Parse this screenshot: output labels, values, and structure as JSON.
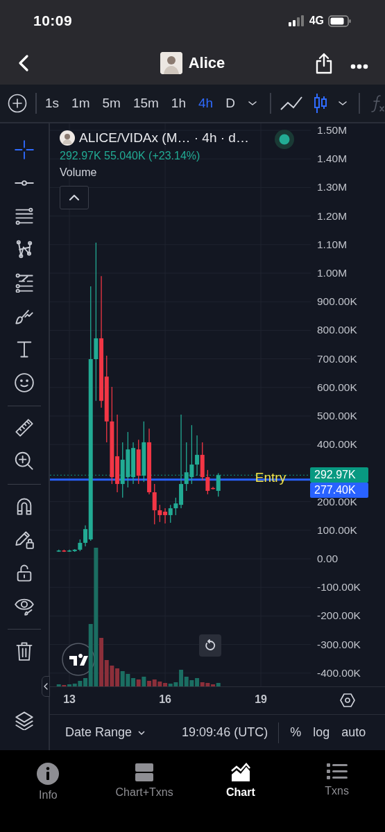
{
  "status_bar": {
    "time": "10:09",
    "network": "4G"
  },
  "header": {
    "title": "Alice"
  },
  "toolbar": {
    "intervals": [
      {
        "label": "1s",
        "selected": false
      },
      {
        "label": "1m",
        "selected": false
      },
      {
        "label": "5m",
        "selected": false
      },
      {
        "label": "15m",
        "selected": false
      },
      {
        "label": "1h",
        "selected": false
      },
      {
        "label": "4h",
        "selected": true
      },
      {
        "label": "D",
        "selected": false
      }
    ],
    "chart_types": [
      {
        "kind": "line",
        "selected": false
      },
      {
        "kind": "candles",
        "selected": true
      }
    ]
  },
  "tool_groups": [
    [
      {
        "kind": "crosshair",
        "selected": true
      },
      {
        "kind": "horizontal-line",
        "selected": false
      },
      {
        "kind": "lines",
        "selected": false
      },
      {
        "kind": "pattern",
        "selected": false
      },
      {
        "kind": "fib",
        "selected": false
      },
      {
        "kind": "brush",
        "selected": false
      },
      {
        "kind": "text",
        "selected": false
      },
      {
        "kind": "emoji",
        "selected": false
      }
    ],
    [
      {
        "kind": "ruler",
        "selected": false
      },
      {
        "kind": "zoom",
        "selected": false
      }
    ],
    [
      {
        "kind": "magnet",
        "selected": false
      },
      {
        "kind": "lock-drawing",
        "selected": false
      },
      {
        "kind": "lock",
        "selected": false
      },
      {
        "kind": "eye",
        "selected": false
      }
    ],
    [
      {
        "kind": "trash",
        "selected": false
      }
    ]
  ],
  "chart": {
    "legend": {
      "symbol": "ALICE/VIDAx (M… · 4h · d…",
      "values": "292.97K 55.040K (+23.14%)",
      "indicator": "Volume"
    },
    "chart_data": {
      "type": "candlestick",
      "x": [
        12.667,
        12.833,
        13,
        13.167,
        13.333,
        13.5,
        13.667,
        13.833,
        14,
        14.167,
        14.333,
        14.5,
        14.667,
        14.833,
        15,
        15.167,
        15.333,
        15.5,
        15.667,
        15.833,
        16,
        16.167,
        16.333,
        16.5,
        16.667,
        16.833,
        17,
        17.167,
        17.333,
        17.5,
        17.667
      ],
      "ohlc": [
        [
          27000,
          32000,
          24000,
          29000
        ],
        [
          29000,
          32000,
          24000,
          27000
        ],
        [
          27000,
          32000,
          24000,
          29000
        ],
        [
          27000,
          34000,
          24000,
          32000
        ],
        [
          32000,
          68000,
          27000,
          56000
        ],
        [
          56000,
          117000,
          44000,
          104000
        ],
        [
          68000,
          954000,
          63000,
          699000
        ],
        [
          699000,
          1107000,
          553000,
          772000
        ],
        [
          772000,
          990000,
          529000,
          553000
        ],
        [
          638000,
          711000,
          408000,
          481000
        ],
        [
          481000,
          602000,
          262000,
          286000
        ],
        [
          359000,
          505000,
          233000,
          262000
        ],
        [
          262000,
          408000,
          214000,
          347000
        ],
        [
          286000,
          444000,
          250000,
          383000
        ],
        [
          286000,
          408000,
          262000,
          388000
        ],
        [
          383000,
          417000,
          262000,
          291000
        ],
        [
          291000,
          481000,
          269000,
          408000
        ],
        [
          408000,
          456000,
          226000,
          233000
        ],
        [
          233000,
          262000,
          121000,
          170000
        ],
        [
          170000,
          189000,
          129000,
          153000
        ],
        [
          165000,
          177000,
          124000,
          153000
        ],
        [
          153000,
          189000,
          126000,
          177000
        ],
        [
          177000,
          214000,
          153000,
          194000
        ],
        [
          189000,
          505000,
          177000,
          262000
        ],
        [
          262000,
          408000,
          238000,
          303000
        ],
        [
          286000,
          468000,
          262000,
          330000
        ],
        [
          330000,
          432000,
          291000,
          364000
        ],
        [
          364000,
          408000,
          274000,
          286000
        ],
        [
          286000,
          311000,
          226000,
          238000
        ],
        [
          248000,
          252000,
          243000,
          247000
        ],
        [
          238000,
          300000,
          218000,
          292970
        ]
      ],
      "xlim": [
        12.39,
        22.89
      ],
      "grid": true,
      "ylim": [
        -669900,
        1524300
      ],
      "xticks": [
        13,
        16,
        19
      ],
      "yticks": [
        {
          "value": 1500000,
          "label": "1.50M"
        },
        {
          "value": 1400000,
          "label": "1.40M"
        },
        {
          "value": 1300000,
          "label": "1.30M"
        },
        {
          "value": 1200000,
          "label": "1.20M"
        },
        {
          "value": 1100000,
          "label": "1.10M"
        },
        {
          "value": 1000000,
          "label": "1.00M"
        },
        {
          "value": 900000,
          "label": "900.00K"
        },
        {
          "value": 800000,
          "label": "800.00K"
        },
        {
          "value": 700000,
          "label": "700.00K"
        },
        {
          "value": 600000,
          "label": "600.00K"
        },
        {
          "value": 500000,
          "label": "500.00K"
        },
        {
          "value": 400000,
          "label": "400.00K"
        },
        {
          "value": 200000,
          "label": "200.00K"
        },
        {
          "value": 100000,
          "label": "100.00K"
        },
        {
          "value": 0,
          "label": "0.00"
        },
        {
          "value": -100000,
          "label": "-100.00K"
        },
        {
          "value": -200000,
          "label": "-200.00K"
        },
        {
          "value": -300000,
          "label": "-300.00K"
        },
        {
          "value": -400000,
          "label": "-400.00K"
        }
      ],
      "ref_lines": [
        {
          "axis": "y",
          "value": 292970,
          "label": "292.97K",
          "color": "#089981"
        },
        {
          "axis": "y",
          "value": 277400,
          "label": "277.40K",
          "color": "#2962ff"
        }
      ],
      "annotations": [
        "Entry"
      ]
    }
  },
  "bottom_bar": {
    "date_range": "Date Range",
    "clock": "19:09:46 (UTC)",
    "options": [
      "%",
      "log",
      "auto"
    ]
  },
  "tab_bar": [
    {
      "label": "Info",
      "kind": "info",
      "selected": false
    },
    {
      "label": "Chart+Txns",
      "kind": "split",
      "selected": false
    },
    {
      "label": "Chart",
      "kind": "chart",
      "selected": true
    },
    {
      "label": "Txns",
      "kind": "list",
      "selected": false
    }
  ]
}
